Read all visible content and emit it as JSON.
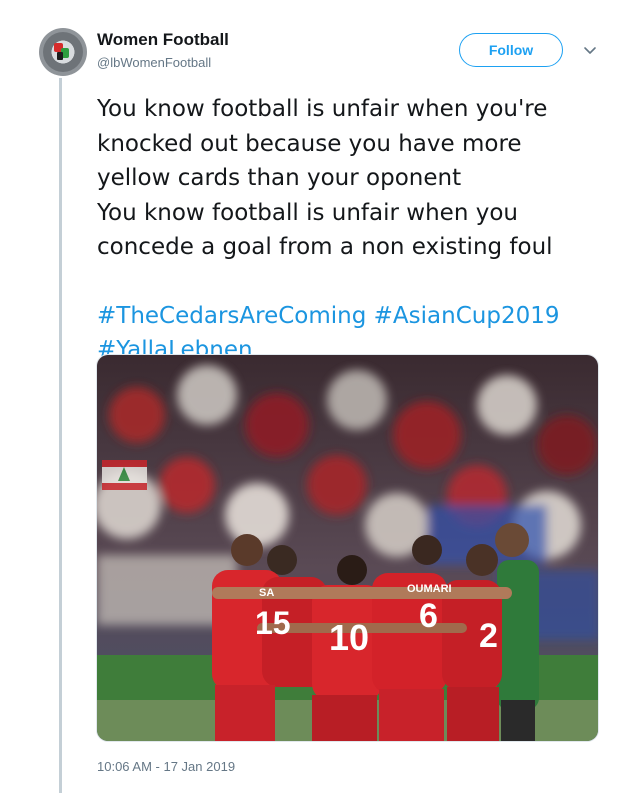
{
  "tweet": {
    "display_name": "Women Football",
    "handle": "@lbWomenFootball",
    "follow_label": "Follow",
    "text_lines": [
      "You know football is unfair when you're",
      "knocked out because you have more",
      "yellow cards than your oponent",
      "You know football is unfair when you",
      "concede a goal from a non existing foul"
    ],
    "hashtags": {
      "tag1": "#TheCedarsAreComing",
      "tag2": "#AsianCup2019",
      "tag3": "#YallaLebnen"
    },
    "photo": {
      "jersey_names": {
        "left": "SA",
        "center": "OUMARI"
      },
      "jersey_numbers": {
        "n15": "15",
        "n10": "10",
        "n6": "6",
        "n2": "2"
      }
    },
    "timestamp": "10:06 AM - 17 Jan 2019"
  },
  "colors": {
    "link_blue": "#1b95e0",
    "follow_blue": "#1da1f2",
    "secondary_text": "#657786",
    "thread_line": "#c4cfd6",
    "jersey_red": "#d8262c"
  },
  "icons": {
    "avatar": "lebanon-map-logo",
    "chevron": "chevron-down-icon"
  }
}
